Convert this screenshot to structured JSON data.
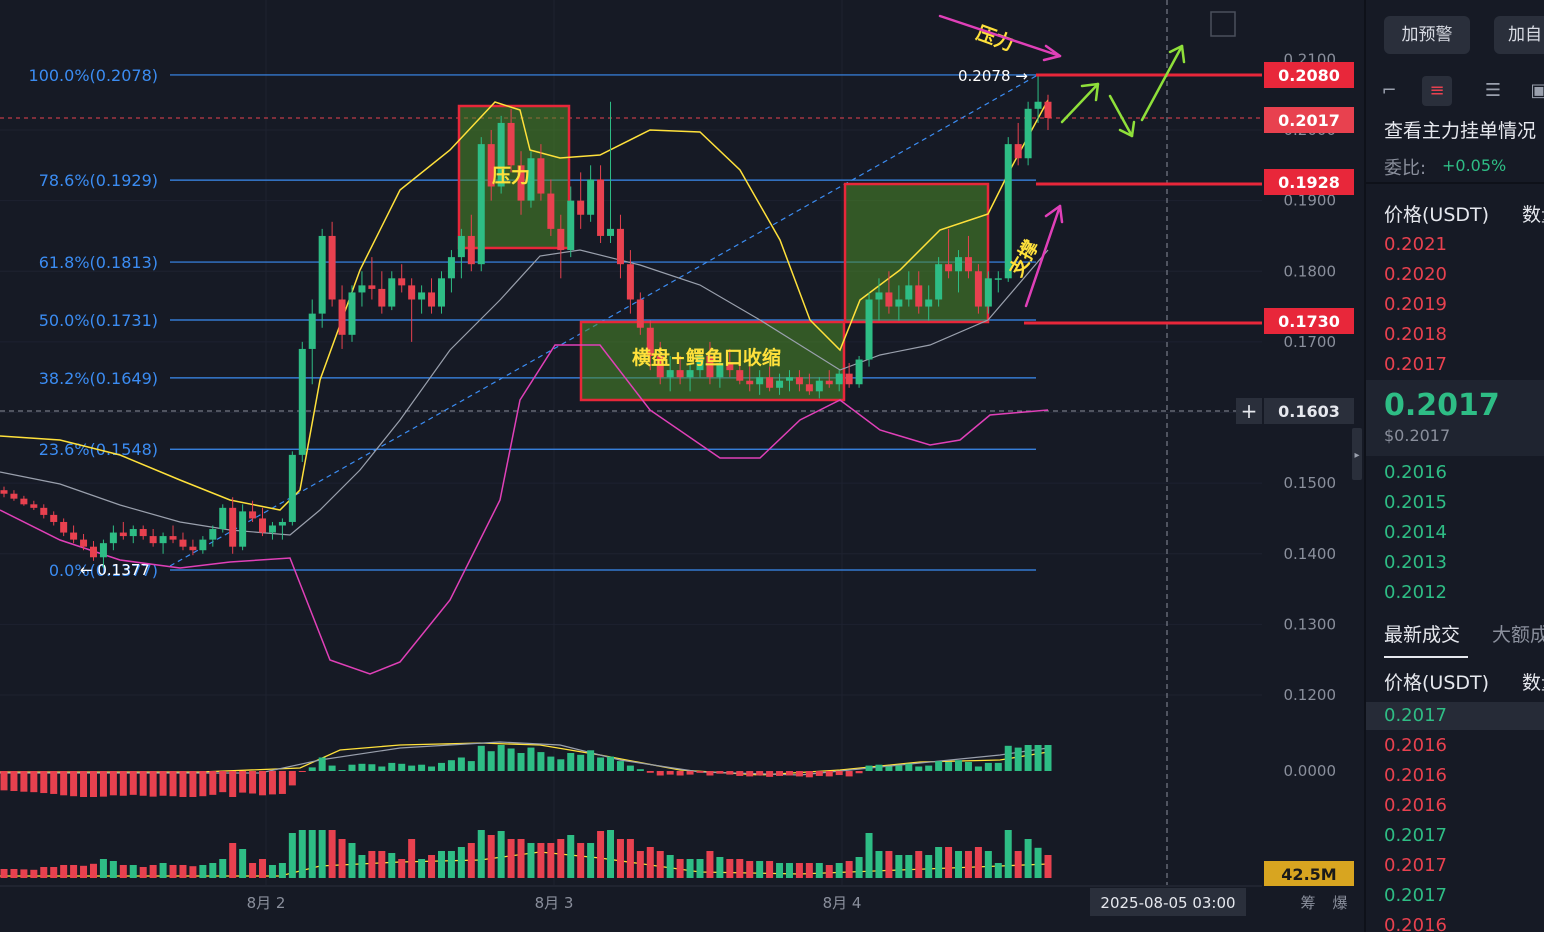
{
  "chart_data": {
    "type": "candlestick",
    "symbol_quote": "USDT",
    "x_labels": [
      "8月 2",
      "8月 3",
      "8月 4"
    ],
    "crosshair_time": "2025-08-05 03:00",
    "y_ticks": [
      "0.2100",
      "0.2000",
      "0.1900",
      "0.1800",
      "0.1700",
      "0.1300",
      "0.1200",
      "0.1500",
      "0.1400"
    ],
    "y_ticks_hidden_note": "",
    "price_tags": {
      "resistance_line": "0.2080",
      "current": "0.2017",
      "line_1928": "0.1928",
      "line_1730": "0.1730",
      "crosshair": "0.1603",
      "volume": "42.5M",
      "macd_zero": "0.0000"
    },
    "fib_levels": [
      {
        "label": "100.0%(0.2078)",
        "value": 0.2078
      },
      {
        "label": "78.6%(0.1929)",
        "value": 0.1929
      },
      {
        "label": "61.8%(0.1813)",
        "value": 0.1813
      },
      {
        "label": "50.0%(0.1731)",
        "value": 0.1731
      },
      {
        "label": "38.2%(0.1649)",
        "value": 0.1649
      },
      {
        "label": "23.6%(0.1548)",
        "value": 0.1548
      },
      {
        "label": "0.0%(0.1377)",
        "value": 0.1377
      }
    ],
    "high_marker": "0.2078",
    "low_marker": "0.1377",
    "annotations": {
      "pressure_box": "压力",
      "consolidation_box": "横盘+鳄鱼口收缩",
      "top_pressure": "压力",
      "support": "支撑"
    },
    "bottom_icons": [
      "筹",
      "爆"
    ],
    "candles": [
      [
        0.149,
        0.1495,
        0.148,
        0.1485
      ],
      [
        0.1485,
        0.149,
        0.1475,
        0.1478
      ],
      [
        0.1478,
        0.1482,
        0.1468,
        0.147
      ],
      [
        0.147,
        0.1475,
        0.1462,
        0.1465
      ],
      [
        0.1465,
        0.147,
        0.145,
        0.1455
      ],
      [
        0.1455,
        0.146,
        0.144,
        0.1445
      ],
      [
        0.1445,
        0.145,
        0.1425,
        0.143
      ],
      [
        0.143,
        0.144,
        0.1415,
        0.142
      ],
      [
        0.142,
        0.1428,
        0.1405,
        0.141
      ],
      [
        0.141,
        0.1418,
        0.139,
        0.1395
      ],
      [
        0.1395,
        0.142,
        0.138,
        0.1415
      ],
      [
        0.1415,
        0.144,
        0.1405,
        0.143
      ],
      [
        0.143,
        0.1445,
        0.142,
        0.1425
      ],
      [
        0.1425,
        0.144,
        0.1415,
        0.1435
      ],
      [
        0.1435,
        0.144,
        0.142,
        0.1425
      ],
      [
        0.1425,
        0.1435,
        0.141,
        0.1415
      ],
      [
        0.1415,
        0.143,
        0.14,
        0.1425
      ],
      [
        0.1425,
        0.144,
        0.1415,
        0.142
      ],
      [
        0.142,
        0.143,
        0.1405,
        0.141
      ],
      [
        0.141,
        0.142,
        0.1398,
        0.1405
      ],
      [
        0.1405,
        0.1425,
        0.14,
        0.142
      ],
      [
        0.142,
        0.144,
        0.141,
        0.1435
      ],
      [
        0.1435,
        0.147,
        0.143,
        0.1465
      ],
      [
        0.1465,
        0.148,
        0.14,
        0.141
      ],
      [
        0.141,
        0.147,
        0.1405,
        0.146
      ],
      [
        0.146,
        0.1475,
        0.1445,
        0.145
      ],
      [
        0.145,
        0.1465,
        0.1425,
        0.143
      ],
      [
        0.143,
        0.1445,
        0.142,
        0.144
      ],
      [
        0.144,
        0.145,
        0.142,
        0.1445
      ],
      [
        0.1445,
        0.1545,
        0.144,
        0.154
      ],
      [
        0.154,
        0.17,
        0.153,
        0.169
      ],
      [
        0.169,
        0.176,
        0.164,
        0.174
      ],
      [
        0.174,
        0.186,
        0.172,
        0.185
      ],
      [
        0.185,
        0.187,
        0.175,
        0.176
      ],
      [
        0.176,
        0.178,
        0.169,
        0.171
      ],
      [
        0.171,
        0.178,
        0.17,
        0.177
      ],
      [
        0.177,
        0.18,
        0.175,
        0.178
      ],
      [
        0.178,
        0.182,
        0.176,
        0.1775
      ],
      [
        0.1775,
        0.18,
        0.174,
        0.175
      ],
      [
        0.175,
        0.18,
        0.1745,
        0.179
      ],
      [
        0.179,
        0.181,
        0.177,
        0.178
      ],
      [
        0.178,
        0.179,
        0.17,
        0.176
      ],
      [
        0.176,
        0.178,
        0.174,
        0.177
      ],
      [
        0.177,
        0.179,
        0.174,
        0.175
      ],
      [
        0.175,
        0.18,
        0.174,
        0.179
      ],
      [
        0.179,
        0.183,
        0.177,
        0.182
      ],
      [
        0.182,
        0.186,
        0.179,
        0.185
      ],
      [
        0.185,
        0.188,
        0.18,
        0.181
      ],
      [
        0.181,
        0.199,
        0.18,
        0.198
      ],
      [
        0.198,
        0.2,
        0.19,
        0.192
      ],
      [
        0.192,
        0.202,
        0.191,
        0.201
      ],
      [
        0.201,
        0.203,
        0.194,
        0.195
      ],
      [
        0.195,
        0.197,
        0.188,
        0.19
      ],
      [
        0.19,
        0.197,
        0.189,
        0.196
      ],
      [
        0.196,
        0.198,
        0.19,
        0.191
      ],
      [
        0.191,
        0.193,
        0.185,
        0.186
      ],
      [
        0.186,
        0.188,
        0.179,
        0.183
      ],
      [
        0.183,
        0.192,
        0.182,
        0.19
      ],
      [
        0.19,
        0.194,
        0.186,
        0.188
      ],
      [
        0.188,
        0.195,
        0.187,
        0.193
      ],
      [
        0.193,
        0.195,
        0.184,
        0.185
      ],
      [
        0.185,
        0.204,
        0.184,
        0.186
      ],
      [
        0.186,
        0.188,
        0.179,
        0.181
      ],
      [
        0.181,
        0.183,
        0.174,
        0.176
      ],
      [
        0.176,
        0.177,
        0.171,
        0.172
      ],
      [
        0.172,
        0.173,
        0.166,
        0.168
      ],
      [
        0.168,
        0.17,
        0.164,
        0.165
      ],
      [
        0.165,
        0.168,
        0.163,
        0.166
      ],
      [
        0.166,
        0.168,
        0.164,
        0.165
      ],
      [
        0.165,
        0.167,
        0.163,
        0.166
      ],
      [
        0.166,
        0.169,
        0.165,
        0.168
      ],
      [
        0.168,
        0.17,
        0.164,
        0.165
      ],
      [
        0.165,
        0.168,
        0.1635,
        0.167
      ],
      [
        0.167,
        0.169,
        0.165,
        0.166
      ],
      [
        0.166,
        0.168,
        0.164,
        0.1645
      ],
      [
        0.1645,
        0.1665,
        0.163,
        0.164
      ],
      [
        0.164,
        0.166,
        0.1625,
        0.165
      ],
      [
        0.165,
        0.1665,
        0.163,
        0.1635
      ],
      [
        0.1635,
        0.1655,
        0.1625,
        0.1645
      ],
      [
        0.1645,
        0.166,
        0.163,
        0.165
      ],
      [
        0.165,
        0.166,
        0.163,
        0.164
      ],
      [
        0.164,
        0.1655,
        0.1625,
        0.163
      ],
      [
        0.163,
        0.165,
        0.162,
        0.1645
      ],
      [
        0.1645,
        0.166,
        0.1635,
        0.164
      ],
      [
        0.164,
        0.166,
        0.163,
        0.1655
      ],
      [
        0.1655,
        0.167,
        0.1635,
        0.164
      ],
      [
        0.164,
        0.168,
        0.1635,
        0.1675
      ],
      [
        0.1675,
        0.177,
        0.1665,
        0.176
      ],
      [
        0.176,
        0.179,
        0.173,
        0.177
      ],
      [
        0.177,
        0.18,
        0.174,
        0.175
      ],
      [
        0.175,
        0.178,
        0.173,
        0.176
      ],
      [
        0.176,
        0.18,
        0.175,
        0.178
      ],
      [
        0.178,
        0.18,
        0.174,
        0.175
      ],
      [
        0.175,
        0.178,
        0.173,
        0.176
      ],
      [
        0.176,
        0.182,
        0.175,
        0.181
      ],
      [
        0.181,
        0.186,
        0.179,
        0.18
      ],
      [
        0.18,
        0.183,
        0.177,
        0.182
      ],
      [
        0.182,
        0.185,
        0.179,
        0.18
      ],
      [
        0.18,
        0.181,
        0.174,
        0.175
      ],
      [
        0.175,
        0.18,
        0.174,
        0.179
      ],
      [
        0.179,
        0.18,
        0.177,
        0.179
      ],
      [
        0.179,
        0.199,
        0.1785,
        0.198
      ],
      [
        0.198,
        0.201,
        0.195,
        0.196
      ],
      [
        0.196,
        0.204,
        0.195,
        0.203
      ],
      [
        0.203,
        0.2078,
        0.201,
        0.204
      ],
      [
        0.204,
        0.205,
        0.2,
        0.2017
      ]
    ]
  },
  "panel": {
    "buttons": [
      "加预警",
      "加自"
    ],
    "orderbook_title": "查看主力挂单情况",
    "ratio_label": "委比:",
    "ratio_value": "+0.05%",
    "col_price": "价格(USDT)",
    "col_qty": "数量",
    "asks": [
      "0.2021",
      "0.2020",
      "0.2019",
      "0.2018",
      "0.2017"
    ],
    "last_price": "0.2017",
    "last_price_usd": "$0.2017",
    "bids": [
      "0.2016",
      "0.2015",
      "0.2014",
      "0.2013",
      "0.2012"
    ],
    "trades_tab": "最新成交",
    "trades_tab2": "大额成",
    "trades_col_price": "价格(USDT)",
    "trades_col_qty": "数量",
    "trades": [
      {
        "p": "0.2017",
        "c": "green"
      },
      {
        "p": "0.2016",
        "c": "red"
      },
      {
        "p": "0.2016",
        "c": "red"
      },
      {
        "p": "0.2016",
        "c": "red"
      },
      {
        "p": "0.2017",
        "c": "green"
      },
      {
        "p": "0.2017",
        "c": "red"
      },
      {
        "p": "0.2017",
        "c": "green"
      },
      {
        "p": "0.2016",
        "c": "red"
      }
    ],
    "colors": {
      "red": "#e8414f",
      "green": "#2ebd85",
      "accent_red": "#e8273a",
      "fib_blue": "#3b8cf2",
      "yellow": "#ffe13b"
    }
  }
}
